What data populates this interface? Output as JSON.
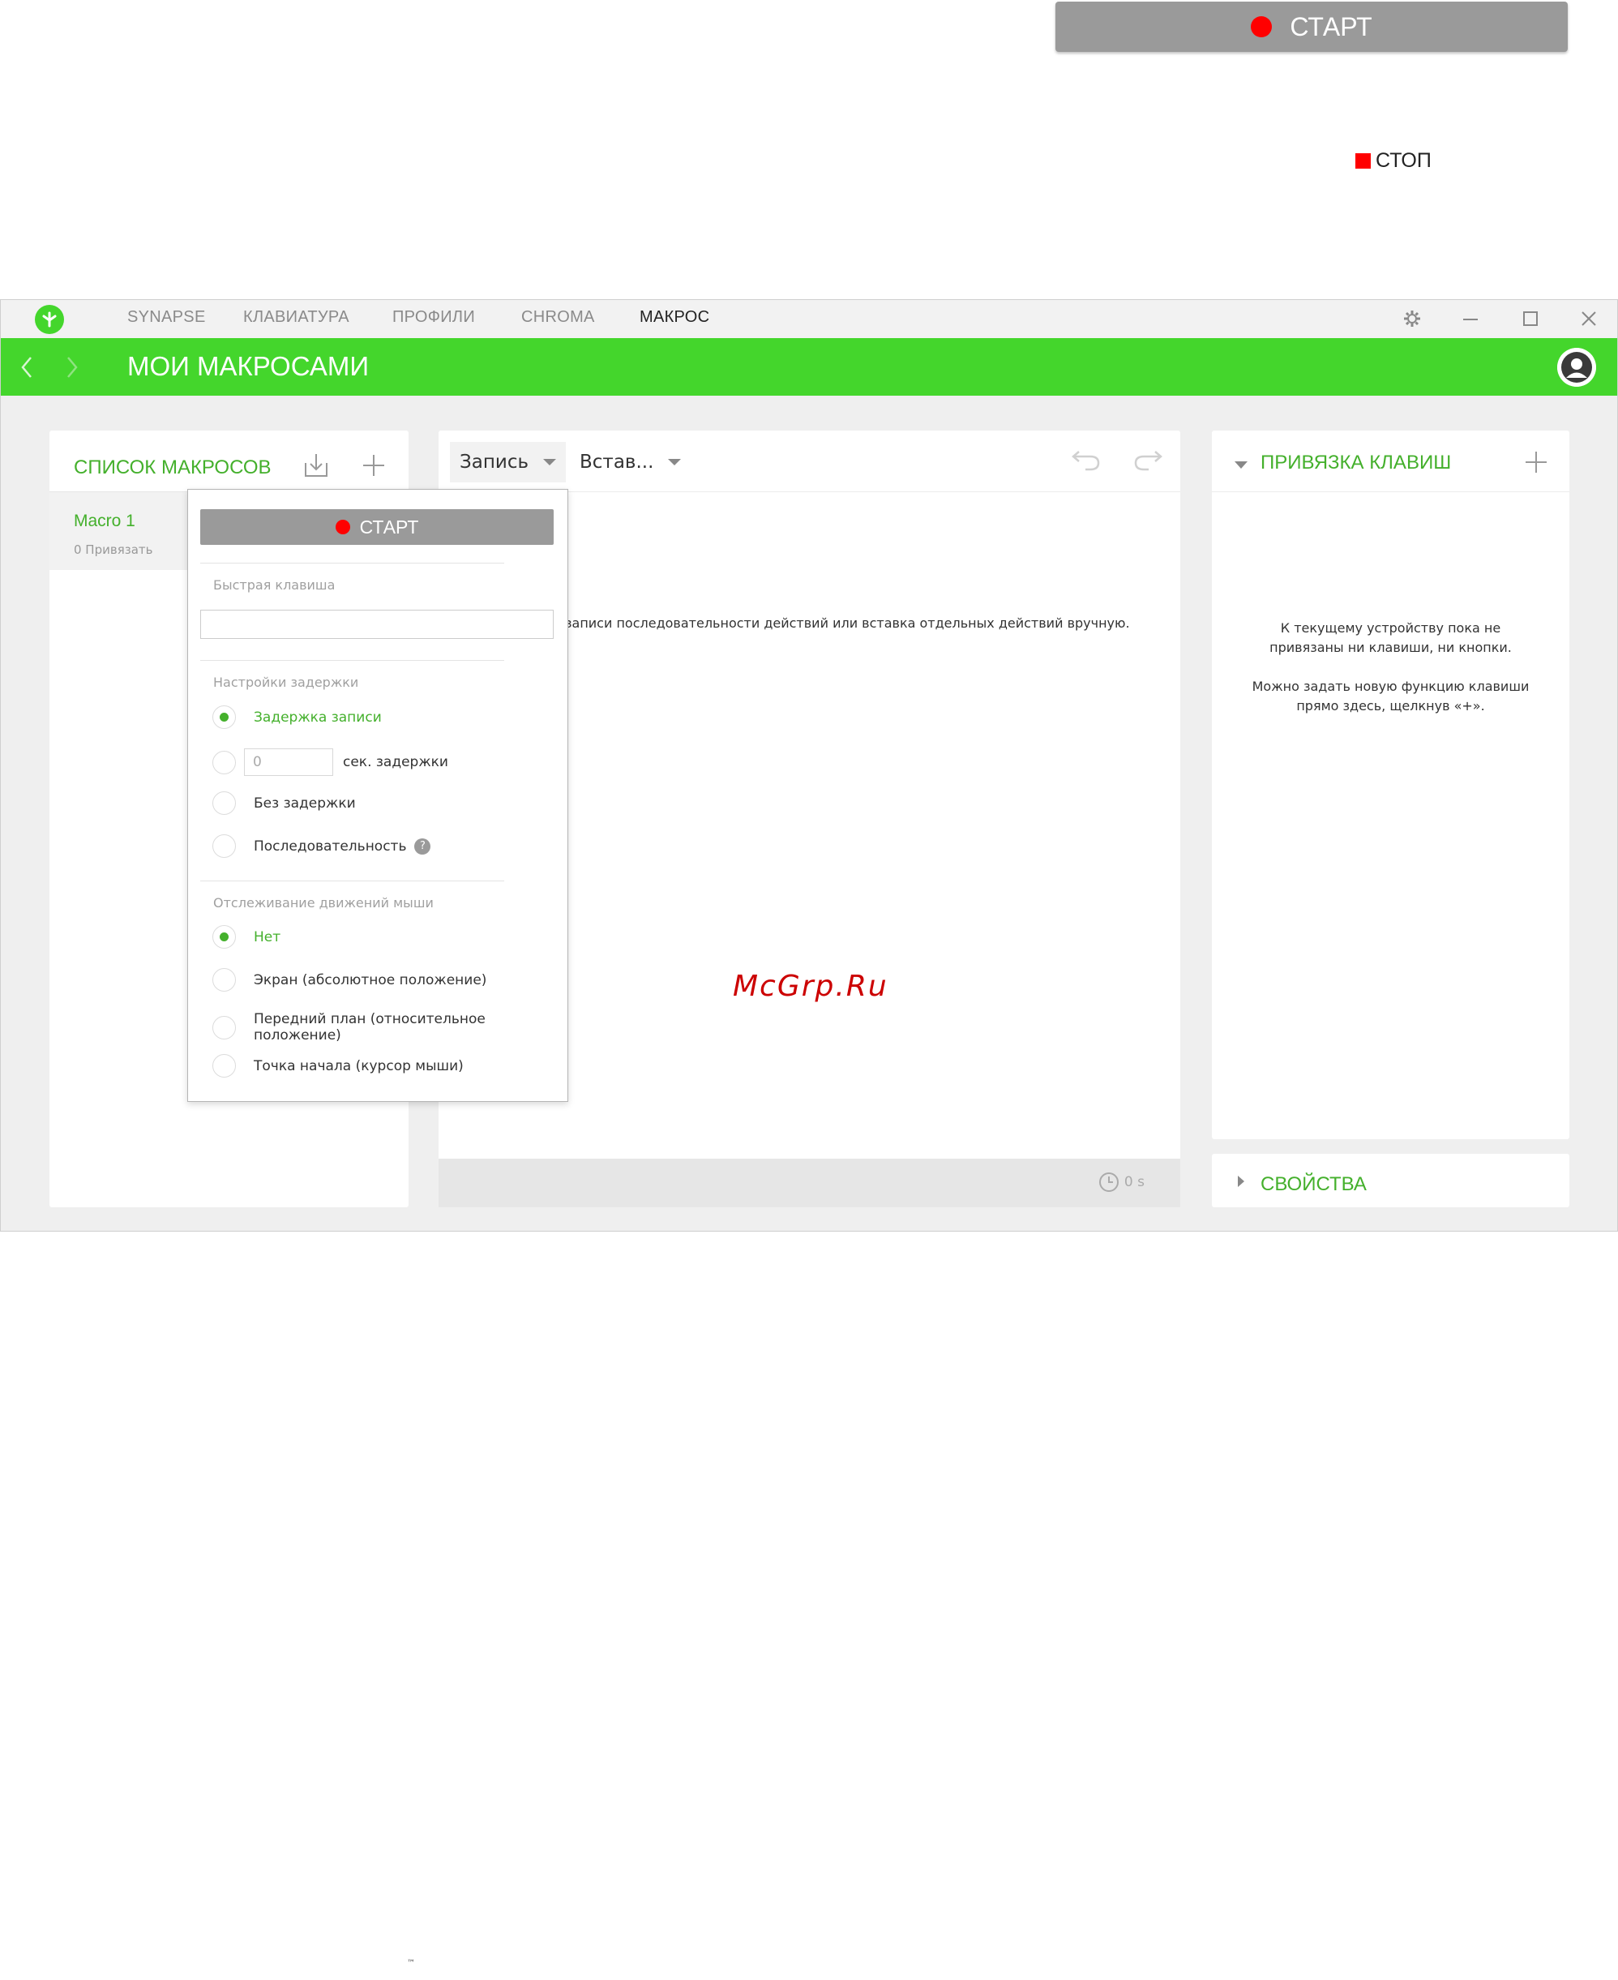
{
  "illustration": {
    "start_button_label": "СТАРТ",
    "stop_label": "СТОП"
  },
  "titlebar": {
    "tabs": [
      {
        "label": "SYNAPSE",
        "active": false
      },
      {
        "label": "КЛАВИАТУРА",
        "active": false
      },
      {
        "label": "ПРОФИЛИ",
        "active": false
      },
      {
        "label": "CHROMA",
        "active": false
      },
      {
        "label": "МАКРОС",
        "active": true
      }
    ],
    "icons": [
      "gear-icon",
      "minimize-icon",
      "maximize-icon",
      "close-icon"
    ]
  },
  "header": {
    "title": "МОИ МАКРОСАМИ",
    "accent_color": "#44d62c"
  },
  "macro_list": {
    "title": "СПИСОК МАКРОСОВ",
    "items": [
      {
        "name": "Macro 1",
        "subtitle": "0 Привязать"
      }
    ]
  },
  "editor": {
    "record_dropdown": "Запись",
    "insert_dropdown": "Встав...",
    "hint_visible_part": "записи последовательности действий или вставка отдельных действий вручную.",
    "duration": "0 s"
  },
  "record_popup": {
    "start_label": "СТАРТ",
    "hotkey_label": "Быстрая клавиша",
    "hotkey_value": "",
    "delay_section": "Настройки задержки",
    "delay_options": [
      {
        "label": "Задержка записи",
        "selected": true
      },
      {
        "label": "сек. задержки",
        "selected": false,
        "input_placeholder": "0"
      },
      {
        "label": "Без задержки",
        "selected": false
      },
      {
        "label": "Последовательность",
        "selected": false
      }
    ],
    "mouse_section": "Отслеживание движений мыши",
    "mouse_options": [
      {
        "label": "Нет",
        "selected": true
      },
      {
        "label": "Экран (абсолютное положение)",
        "selected": false
      },
      {
        "label": "Передний план (относительное положение)",
        "selected": false
      },
      {
        "label": "Точка начала (курсор мыши)",
        "selected": false
      }
    ]
  },
  "binding": {
    "title": "ПРИВЯЗКА КЛАВИШ",
    "message_1": "К текущему устройству пока не привязаны ни клавиши, ни кнопки.",
    "message_2": "Можно задать новую функцию клавиши прямо здесь, щелкнув «+»."
  },
  "properties": {
    "title": "СВОЙСТВА"
  },
  "watermark": "McGrp.Ru",
  "tm": "™"
}
